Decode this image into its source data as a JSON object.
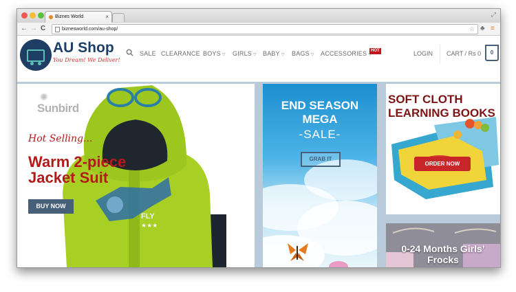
{
  "browser": {
    "tab_title": "Biznes World",
    "tab_close": "×",
    "url": "biznesworld.com/au-shop/",
    "back": "←",
    "forward": "→",
    "reload": "C",
    "star": "☆",
    "menu": "≡"
  },
  "site": {
    "brand": "AU Shop",
    "tagline": "You Dream! We Deliver!",
    "nav": [
      "SALE",
      "CLEARANCE",
      "BOYS",
      "GIRLS",
      "BABY",
      "BAGS",
      "ACCESSORIES"
    ],
    "hot_badge": "HOT",
    "login": "LOGIN",
    "cart_label": "CART / Rs 0",
    "cart_count": "0"
  },
  "hero": {
    "brand_logo": "Sunbird",
    "kicker": "Hot Selling...",
    "headline": "Warm 2-piece Jacket Suit",
    "button": "BUY NOW",
    "shirt_text": "FLY"
  },
  "promo": {
    "title": "END SEASON MEGA",
    "sale": "-SALE-",
    "button": "GRAB IT"
  },
  "books": {
    "title": "SOFT CLOTH LEARNING BOOKS",
    "button": "ORDER NOW"
  },
  "frocks": {
    "title": "0-24 Months Girls’ Frocks"
  },
  "colors": {
    "accent": "#46607a",
    "red": "#b31b1b",
    "background": "#b9cadb"
  }
}
